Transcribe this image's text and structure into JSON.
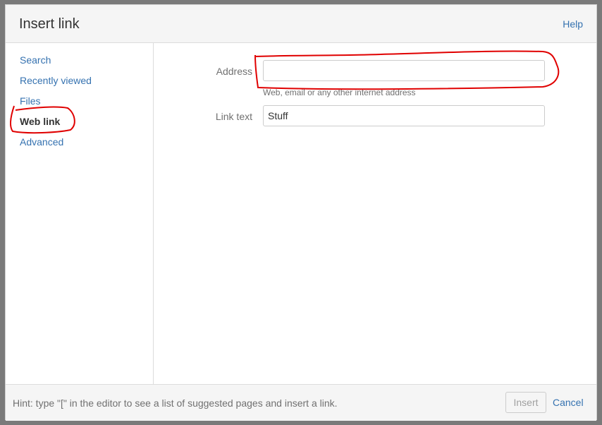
{
  "dialog": {
    "title": "Insert link",
    "help_label": "Help"
  },
  "sidebar": {
    "items": [
      {
        "label": "Search"
      },
      {
        "label": "Recently viewed"
      },
      {
        "label": "Files"
      },
      {
        "label": "Web link"
      },
      {
        "label": "Advanced"
      }
    ],
    "active": "Web link"
  },
  "form": {
    "address_label": "Address",
    "address_value": "",
    "address_description": "Web, email or any other internet address",
    "link_text_label": "Link text",
    "link_text_value": "Stuff"
  },
  "footer": {
    "hint": "Hint: type \"[\" in the editor to see a list of suggested pages and insert a link.",
    "insert_label": "Insert",
    "cancel_label": "Cancel"
  },
  "colors": {
    "link": "#3572b0",
    "annotation": "#e00000"
  }
}
